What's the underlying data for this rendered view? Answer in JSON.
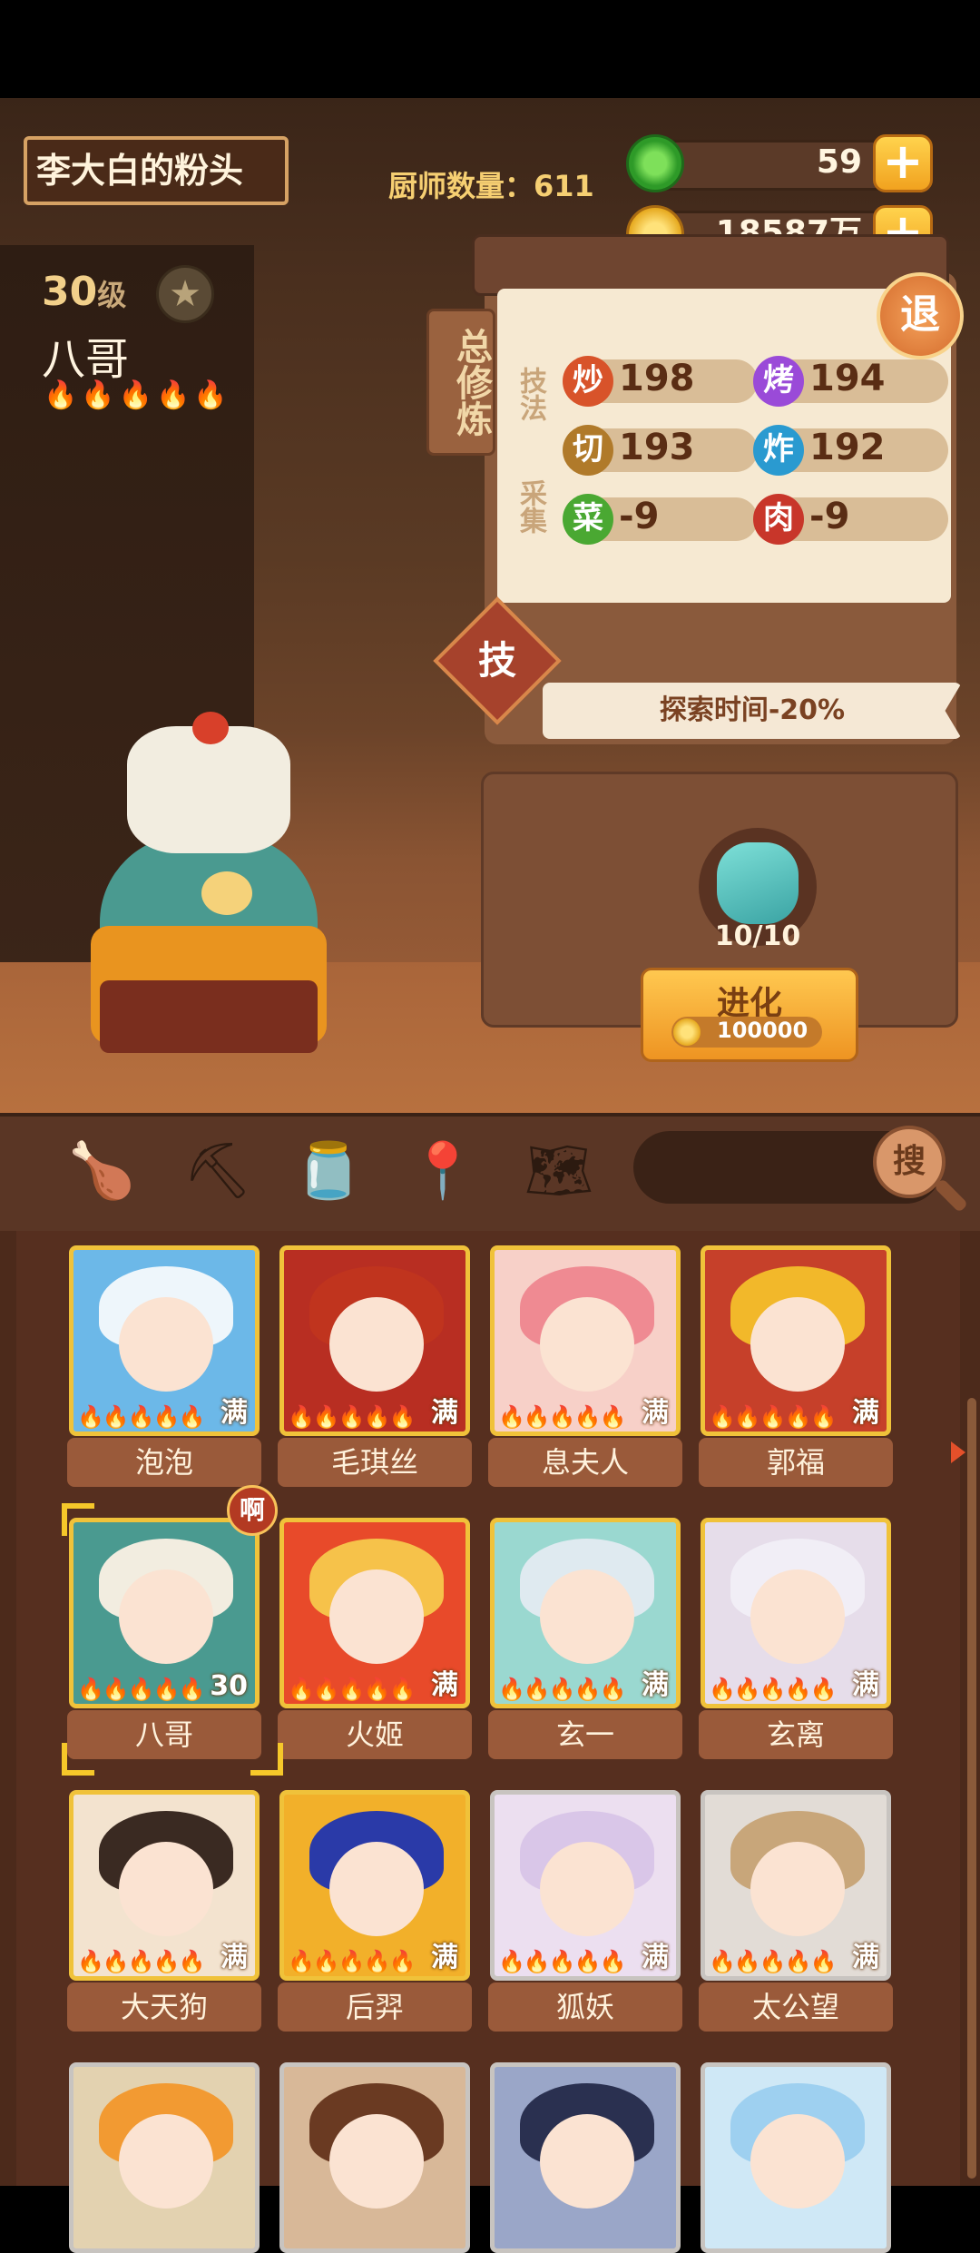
{
  "header": {
    "player_name": "李大白的粉头",
    "chef_count": "厨师数量：611",
    "jade": "59",
    "gold": "18587万"
  },
  "chef": {
    "level": "30",
    "level_unit": "级",
    "name": "八哥",
    "flames": "🔥🔥🔥🔥🔥"
  },
  "panel": {
    "total_training": "总修炼",
    "skills_label": "技法",
    "gather_label": "采集",
    "stats": [
      {
        "icon": "炒",
        "value": "198",
        "color": "#d8532a"
      },
      {
        "icon": "烤",
        "value": "194",
        "color": "#9a4ad8"
      },
      {
        "icon": "切",
        "value": "193",
        "color": "#b07a2a"
      },
      {
        "icon": "炸",
        "value": "192",
        "color": "#2a9ad0"
      },
      {
        "icon": "菜",
        "value": "-9",
        "color": "#4aa832"
      },
      {
        "icon": "肉",
        "value": "-9",
        "color": "#c8362a"
      }
    ],
    "retreat": "退",
    "skill": "技",
    "banner": "探索时间-20%"
  },
  "evolve": {
    "count": "10/10",
    "label": "进化",
    "cost": "100000"
  },
  "toolbar": {
    "icons": [
      "drumstick-icon",
      "shovel-icon",
      "jar-icon",
      "location-icon",
      "map-icon"
    ],
    "search_label": "搜"
  },
  "cards": [
    {
      "name": "泡泡",
      "badge": "满",
      "hair": "#eef6fb",
      "bg": "#6cb8e8",
      "gray": false
    },
    {
      "name": "毛琪丝",
      "badge": "满",
      "hair": "#c0341e",
      "bg": "#b82e22",
      "gray": false
    },
    {
      "name": "息夫人",
      "badge": "满",
      "hair": "#ef8a92",
      "bg": "#f7d0c8",
      "gray": false
    },
    {
      "name": "郭福",
      "badge": "满",
      "hair": "#f2b82a",
      "bg": "#c6402a",
      "gray": false
    },
    {
      "name": "八哥",
      "badge": "30",
      "hair": "#f2ede0",
      "bg": "#4a9a90",
      "gray": false
    },
    {
      "name": "火姬",
      "badge": "满",
      "hair": "#f6c24a",
      "bg": "#e84a2a",
      "gray": false
    },
    {
      "name": "玄一",
      "badge": "满",
      "hair": "#dfeaf0",
      "bg": "#9ad8d0",
      "gray": false
    },
    {
      "name": "玄离",
      "badge": "满",
      "hair": "#f1eef6",
      "bg": "#e6ddea",
      "gray": false
    },
    {
      "name": "大天狗",
      "badge": "满",
      "hair": "#3a2a22",
      "bg": "#f3e3cf",
      "gray": false
    },
    {
      "name": "后羿",
      "badge": "满",
      "hair": "#2a3aa8",
      "bg": "#f2b02a",
      "gray": false
    },
    {
      "name": "狐妖",
      "badge": "满",
      "hair": "#d9c6e8",
      "bg": "#ecdff0",
      "gray": true
    },
    {
      "name": "太公望",
      "badge": "满",
      "hair": "#c8a67a",
      "bg": "#e2dcd6",
      "gray": true
    },
    {
      "name": "",
      "badge": "",
      "hair": "#f29a32",
      "bg": "#e3d2b0",
      "gray": true
    },
    {
      "name": "",
      "badge": "",
      "hair": "#6a3a22",
      "bg": "#d8b898",
      "gray": true
    },
    {
      "name": "",
      "badge": "",
      "hair": "#2a3050",
      "bg": "#9aa6c8",
      "gray": true
    },
    {
      "name": "",
      "badge": "",
      "hair": "#9ed0f0",
      "bg": "#cfe8f6",
      "gray": true
    }
  ],
  "selected_badge": "啊"
}
